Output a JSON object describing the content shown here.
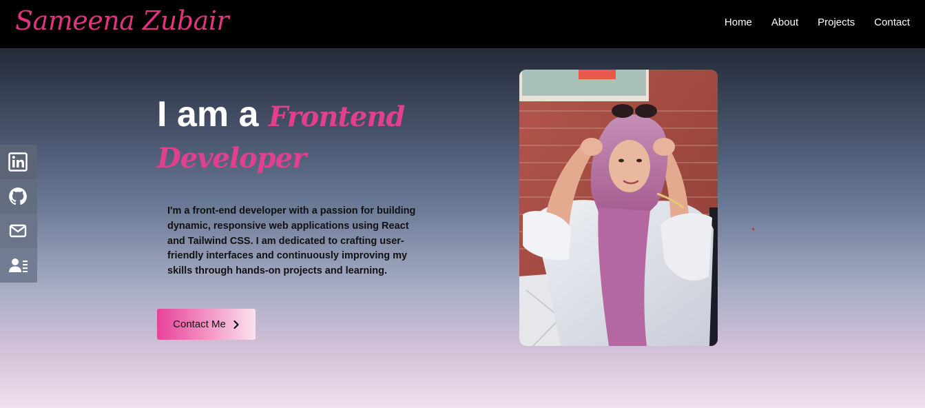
{
  "navbar": {
    "logo": "Sameena Zubair",
    "links": [
      "Home",
      "About",
      "Projects",
      "Contact"
    ]
  },
  "social": {
    "items": [
      {
        "icon": "linkedin-icon"
      },
      {
        "icon": "github-icon"
      },
      {
        "icon": "mail-icon"
      },
      {
        "icon": "resume-icon"
      }
    ]
  },
  "hero": {
    "static_text": "I am a ",
    "role_text": "Frontend Developer",
    "description": "I'm a front-end developer with a passion for building dynamic, responsive web applications using React and Tailwind CSS. I am dedicated to crafting user-friendly interfaces and continuously improving my skills through hands-on projects and learning.",
    "cta_label": "Contact Me"
  },
  "colors": {
    "accent": "#e0408c",
    "navbar_bg": "#000000",
    "nav_text": "#ffffff"
  }
}
